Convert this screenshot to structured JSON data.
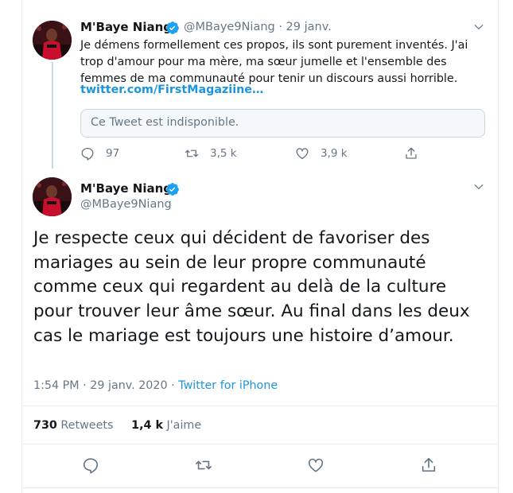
{
  "colors": {
    "text": "#14171a",
    "secondary": "#657786",
    "link": "#1b95e0",
    "verified": "#1da1f2",
    "border": "#e6ecf0"
  },
  "tweet1": {
    "author_name": "M'Baye Niang",
    "handle": "@MBaye9Niang",
    "date": "· 29 janv.",
    "text": "Je démens formellement ces propos, ils sont purement inventés. J'ai trop d'amour pour ma mère, ma sœur jumelle et l'ensemble des femmes de ma communauté pour tenir un discours aussi horrible.",
    "link": "twitter.com/FirstMagaziine…",
    "quoted_unavailable": "Ce Tweet est indisponible.",
    "actions": {
      "replies": "97",
      "retweets": "3,5 k",
      "likes": "3,9 k"
    }
  },
  "tweet2": {
    "author_name": "M'Baye Niang",
    "handle": "@MBaye9Niang",
    "text": "Je respecte ceux qui décident de favoriser des mariages au sein de leur propre communauté comme ceux qui regardent au delà de la culture pour trouver leur âme sœur. Au final dans les deux cas le mariage est toujours une histoire d’amour.",
    "timestamp": "1:54 PM · 29 janv. 2020 · ",
    "source": "Twitter for iPhone",
    "retweets_count": "730",
    "retweets_label": "Retweets",
    "likes_count": "1,4 k",
    "likes_label": "J'aime"
  },
  "icons": [
    "avatar",
    "verified-icon",
    "chevron-down-icon",
    "reply-icon",
    "retweet-icon",
    "like-icon",
    "share-icon"
  ]
}
